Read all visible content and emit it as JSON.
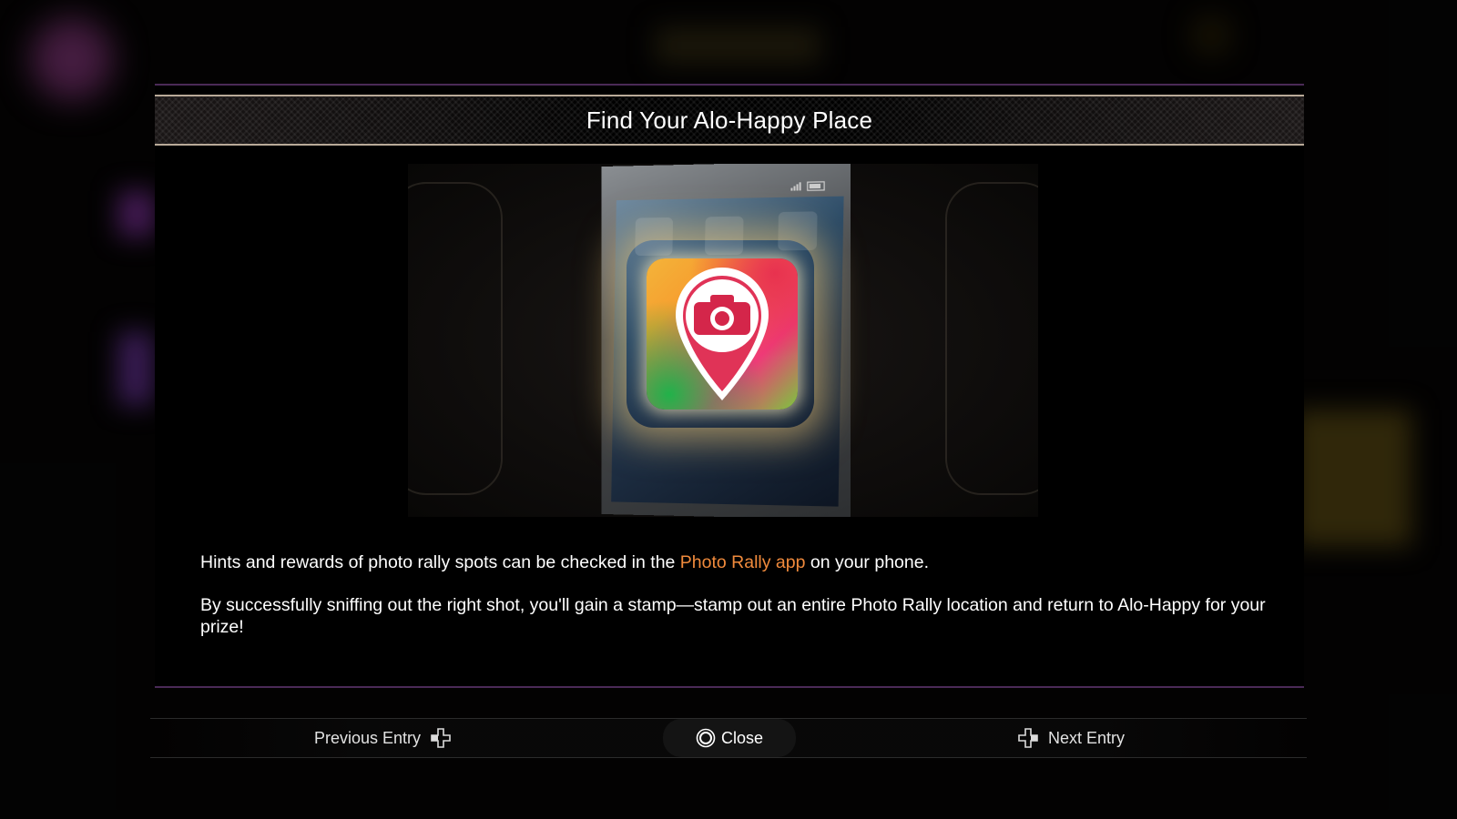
{
  "dialog": {
    "title": "Find Your Alo-Happy Place",
    "illustration": {
      "icon": "photo-rally-app-icon",
      "subject": "phone-with-app"
    },
    "body": {
      "line1_before": "Hints and rewards of photo rally spots can be checked in the ",
      "line1_highlight": "Photo Rally app",
      "line1_after": " on your phone.",
      "line2": "By successfully sniffing out the right shot, you'll gain a stamp—stamp out an entire Photo Rally location and return to Alo-Happy for your prize!"
    }
  },
  "footer": {
    "previous_label": "Previous Entry",
    "previous_icon": "dpad-left-icon",
    "close_label": "Close",
    "close_icon": "circle-button-icon",
    "next_label": "Next Entry",
    "next_icon": "dpad-right-icon"
  },
  "colors": {
    "highlight": "#f08a3c",
    "frame_line": "#b9aa98",
    "dialog_edge": "#4a2a57"
  }
}
